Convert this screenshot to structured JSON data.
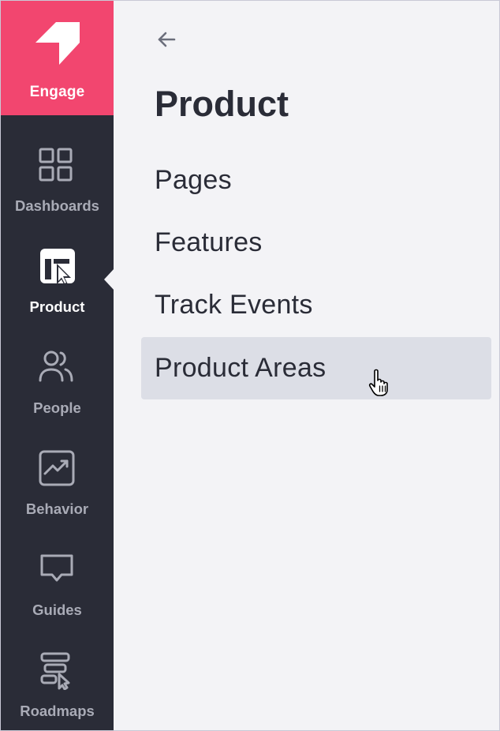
{
  "brand": {
    "label": "Engage",
    "color": "#f2466f"
  },
  "sidebar": {
    "background": "#2a2c37",
    "items": [
      {
        "label": "Dashboards",
        "icon": "grid-icon",
        "active": false
      },
      {
        "label": "Product",
        "icon": "product-cursor-icon",
        "active": true
      },
      {
        "label": "People",
        "icon": "people-icon",
        "active": false
      },
      {
        "label": "Behavior",
        "icon": "chart-trend-icon",
        "active": false
      },
      {
        "label": "Guides",
        "icon": "message-bubble-icon",
        "active": false
      },
      {
        "label": "Roadmaps",
        "icon": "roadmap-icon",
        "active": false
      }
    ]
  },
  "panel": {
    "back_icon": "arrow-left-icon",
    "title": "Product",
    "items": [
      {
        "label": "Pages"
      },
      {
        "label": "Features"
      },
      {
        "label": "Track Events"
      },
      {
        "label": "Product Areas",
        "hovered": true
      }
    ],
    "hover_color": "#dcdee6",
    "pointer_icon": "hand-pointer-icon"
  }
}
